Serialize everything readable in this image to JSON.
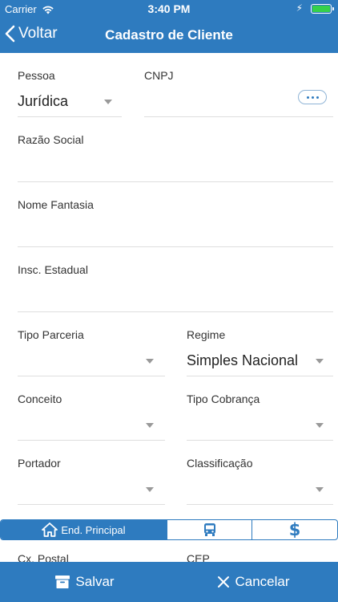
{
  "status": {
    "carrier": "Carrier",
    "time": "3:40 PM"
  },
  "nav": {
    "back_label": "Voltar",
    "title": "Cadastro de Cliente"
  },
  "form": {
    "pessoa": {
      "label": "Pessoa",
      "value": "Jurídica"
    },
    "cnpj": {
      "label": "CNPJ",
      "value": ""
    },
    "razao_social": {
      "label": "Razão Social",
      "value": ""
    },
    "nome_fantasia": {
      "label": "Nome Fantasia",
      "value": ""
    },
    "insc_estadual": {
      "label": "Insc. Estadual",
      "value": ""
    },
    "tipo_parceria": {
      "label": "Tipo Parceria",
      "value": ""
    },
    "regime": {
      "label": "Regime",
      "value": "Simples Nacional"
    },
    "conceito": {
      "label": "Conceito",
      "value": ""
    },
    "tipo_cobranca": {
      "label": "Tipo Cobrança",
      "value": ""
    },
    "portador": {
      "label": "Portador",
      "value": ""
    },
    "classificacao": {
      "label": "Classificação",
      "value": ""
    }
  },
  "tabs": [
    {
      "label": "End. Principal",
      "icon": "home-icon"
    },
    {
      "label": "",
      "icon": "bus-icon"
    },
    {
      "label": "",
      "icon": "dollar-icon"
    }
  ],
  "peek": {
    "cx_postal": "Cx. Postal",
    "cep": "CEP"
  },
  "bottom": {
    "save_label": "Salvar",
    "cancel_label": "Cancelar"
  },
  "colors": {
    "primary": "#2e7bbf",
    "divider": "#dedede",
    "battery": "#35d14a"
  }
}
